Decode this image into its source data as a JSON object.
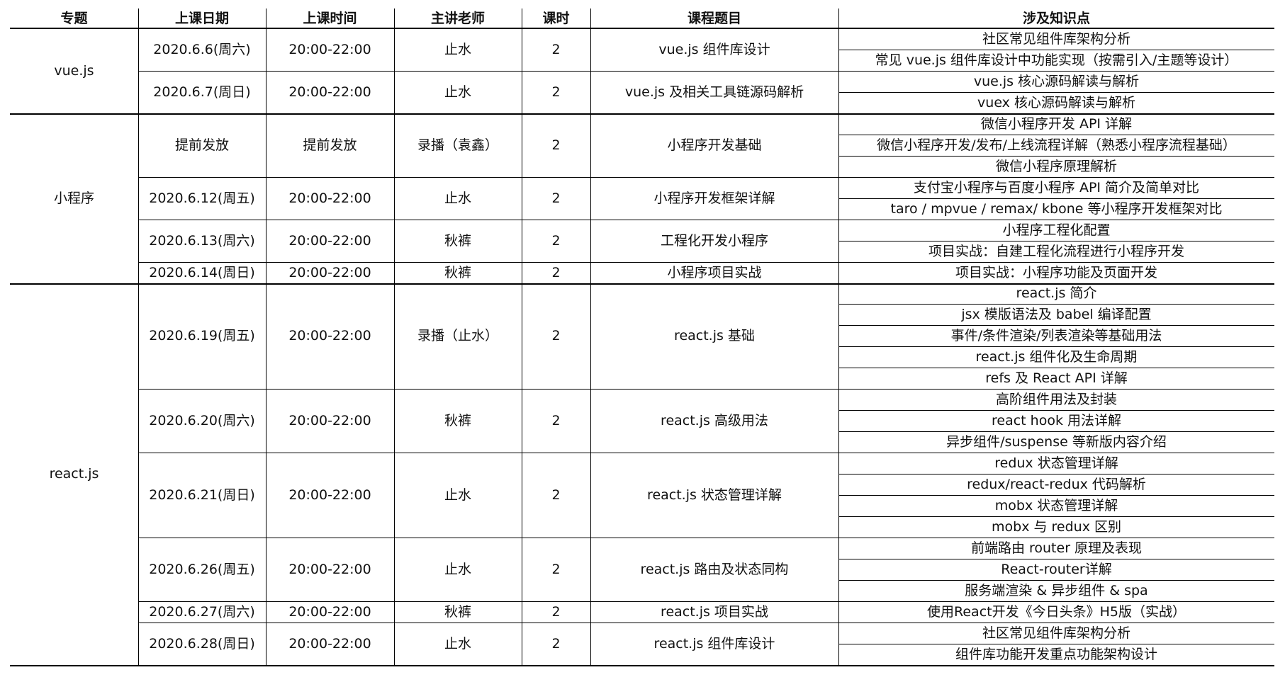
{
  "headers": [
    "专题",
    "上课日期",
    "上课时间",
    "主讲老师",
    "课时",
    "课程题目",
    "涉及知识点"
  ],
  "sections": [
    {
      "topic": "vue.js",
      "lessons": [
        {
          "date": "2020.6.6(周六)",
          "time": "20:00-22:00",
          "teacher": "止水",
          "hours": "2",
          "title": "vue.js 组件库设计",
          "points": [
            "社区常见组件库架构分析",
            "常见 vue.js 组件库设计中功能实现（按需引入/主题等设计）"
          ]
        },
        {
          "date": "2020.6.7(周日)",
          "time": "20:00-22:00",
          "teacher": "止水",
          "hours": "2",
          "title": "vue.js 及相关工具链源码解析",
          "points": [
            "vue.js 核心源码解读与解析",
            "vuex 核心源码解读与解析"
          ]
        }
      ]
    },
    {
      "topic": "小程序",
      "lessons": [
        {
          "date": "提前发放",
          "time": "提前发放",
          "teacher": "录播（袁鑫）",
          "hours": "2",
          "title": "小程序开发基础",
          "points": [
            "微信小程序开发 API 详解",
            "微信小程序开发/发布/上线流程详解（熟悉小程序流程基础）",
            "微信小程序原理解析"
          ]
        },
        {
          "date": "2020.6.12(周五)",
          "time": "20:00-22:00",
          "teacher": "止水",
          "hours": "2",
          "title": "小程序开发框架详解",
          "points": [
            "支付宝小程序与百度小程序 API 简介及简单对比",
            "taro / mpvue / remax/ kbone 等小程序开发框架对比"
          ]
        },
        {
          "date": "2020.6.13(周六)",
          "time": "20:00-22:00",
          "teacher": "秋裤",
          "hours": "2",
          "title": "工程化开发小程序",
          "points": [
            "小程序工程化配置",
            "项目实战：自建工程化流程进行小程序开发"
          ]
        },
        {
          "date": "2020.6.14(周日)",
          "time": "20:00-22:00",
          "teacher": "秋裤",
          "hours": "2",
          "title": "小程序项目实战",
          "points": [
            "项目实战：小程序功能及页面开发"
          ]
        }
      ]
    },
    {
      "topic": "react.js",
      "lessons": [
        {
          "date": "2020.6.19(周五)",
          "time": "20:00-22:00",
          "teacher": "录播（止水）",
          "hours": "2",
          "title": "react.js 基础",
          "points": [
            "react.js 简介",
            "jsx 模版语法及 babel 编译配置",
            "事件/条件渲染/列表渲染等基础用法",
            "react.js 组件化及生命周期",
            "refs 及 React API 详解"
          ]
        },
        {
          "date": "2020.6.20(周六)",
          "time": "20:00-22:00",
          "teacher": "秋裤",
          "hours": "2",
          "title": "react.js 高级用法",
          "points": [
            "高阶组件用法及封装",
            "react hook 用法详解",
            "异步组件/suspense 等新版内容介绍"
          ]
        },
        {
          "date": "2020.6.21(周日)",
          "time": "20:00-22:00",
          "teacher": "止水",
          "hours": "2",
          "title": "react.js 状态管理详解",
          "points": [
            "redux 状态管理详解",
            "redux/react-redux 代码解析",
            "mobx 状态管理详解",
            "mobx 与 redux 区别"
          ]
        },
        {
          "date": "2020.6.26(周五)",
          "time": "20:00-22:00",
          "teacher": "止水",
          "hours": "2",
          "title": "react.js 路由及状态同构",
          "points": [
            "前端路由 router 原理及表现",
            "React-router详解",
            "服务端渲染 & 异步组件 & spa"
          ]
        },
        {
          "date": "2020.6.27(周六)",
          "time": "20:00-22:00",
          "teacher": "秋裤",
          "hours": "2",
          "title": "react.js 项目实战",
          "points": [
            "使用React开发《今日头条》H5版（实战）"
          ]
        },
        {
          "date": "2020.6.28(周日)",
          "time": "20:00-22:00",
          "teacher": "止水",
          "hours": "2",
          "title": "react.js 组件库设计",
          "points": [
            "社区常见组件库架构分析",
            "组件库功能开发重点功能架构设计"
          ]
        }
      ]
    }
  ]
}
